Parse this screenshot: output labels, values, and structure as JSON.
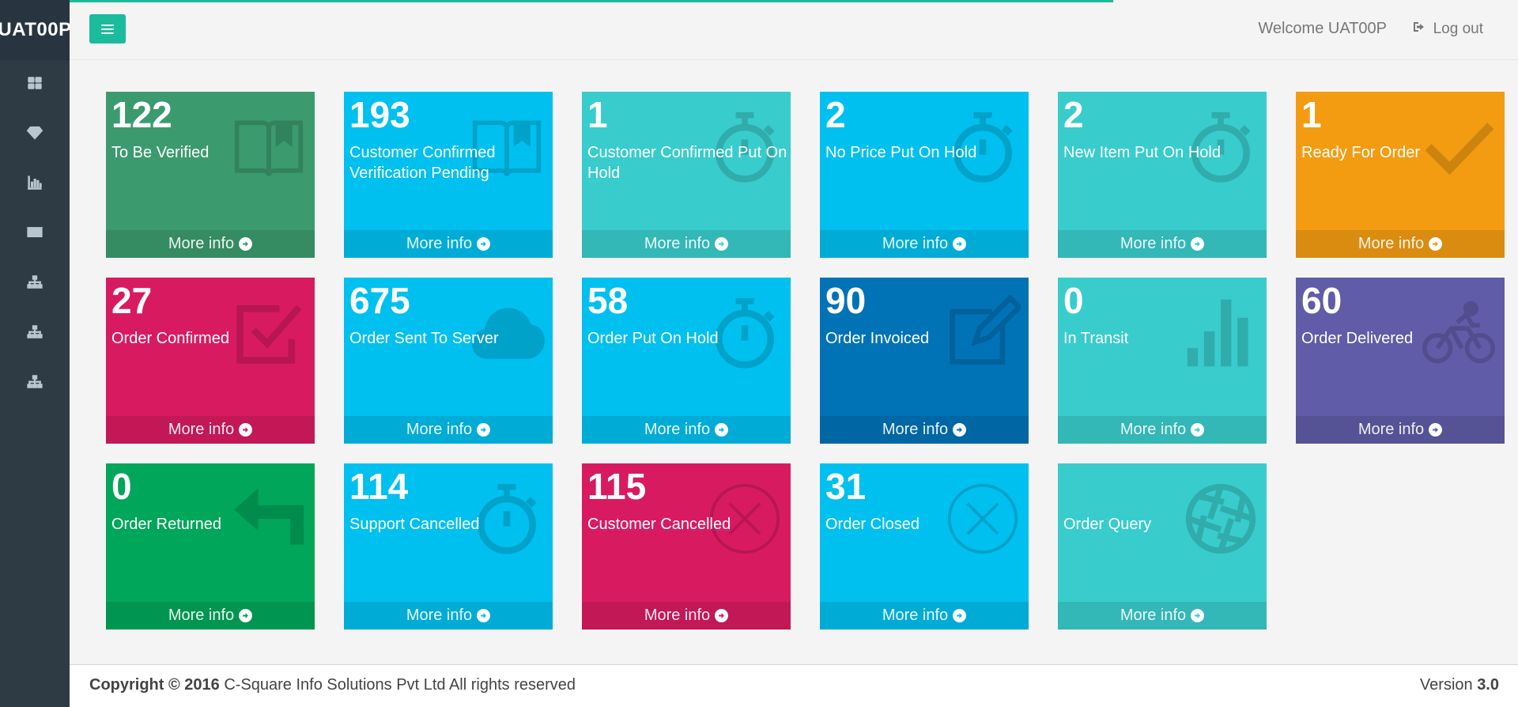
{
  "app": {
    "brand": "UAT00P",
    "welcome": "Welcome UAT00P",
    "logout_label": "Log out"
  },
  "sidebar": {
    "items": [
      {
        "icon": "dashboard-icon"
      },
      {
        "icon": "diamond-icon"
      },
      {
        "icon": "bar-chart-icon"
      },
      {
        "icon": "envelope-icon"
      },
      {
        "icon": "sitemap-icon"
      },
      {
        "icon": "sitemap-icon"
      },
      {
        "icon": "sitemap-icon"
      }
    ]
  },
  "colors": {
    "teal_accent": "#1abc9c",
    "green_dark": "#3c9b6e",
    "aqua": "#00c0ef",
    "turquoise": "#39cccc",
    "orange": "#f39c12",
    "maroon": "#d81b60",
    "blue": "#0073b7",
    "purple": "#605ca8",
    "green": "#00a65a"
  },
  "tiles": [
    {
      "count": "122",
      "label": "To Be Verified",
      "more": "More info",
      "icon": "book-icon",
      "color": "#3c9b6e"
    },
    {
      "count": "193",
      "label": "Customer Confirmed Verification Pending",
      "more": "More info",
      "icon": "book-icon",
      "color": "#00c0ef"
    },
    {
      "count": "1",
      "label": "Customer Confirmed Put On Hold",
      "more": "More info",
      "icon": "stopwatch-icon",
      "color": "#39cccc"
    },
    {
      "count": "2",
      "label": "No Price Put On Hold",
      "more": "More info",
      "icon": "stopwatch-icon",
      "color": "#00c0ef"
    },
    {
      "count": "2",
      "label": "New Item Put On Hold",
      "more": "More info",
      "icon": "stopwatch-icon",
      "color": "#39cccc"
    },
    {
      "count": "1",
      "label": "Ready For Order",
      "more": "More info",
      "icon": "checkmark-icon",
      "color": "#f39c12"
    },
    {
      "count": "27",
      "label": "Order Confirmed",
      "more": "More info",
      "icon": "checkbox-icon",
      "color": "#d81b60"
    },
    {
      "count": "675",
      "label": "Order Sent To Server",
      "more": "More info",
      "icon": "cloud-icon",
      "color": "#00c0ef"
    },
    {
      "count": "58",
      "label": "Order Put On Hold",
      "more": "More info",
      "icon": "stopwatch-icon",
      "color": "#00c0ef"
    },
    {
      "count": "90",
      "label": "Order Invoiced",
      "more": "More info",
      "icon": "edit-icon",
      "color": "#0073b7"
    },
    {
      "count": "0",
      "label": "In Transit",
      "more": "More info",
      "icon": "bar-chart-icon",
      "color": "#39cccc"
    },
    {
      "count": "60",
      "label": "Order Delivered",
      "more": "More info",
      "icon": "bicycle-icon",
      "color": "#605ca8"
    },
    {
      "count": "0",
      "label": "Order Returned",
      "more": "More info",
      "icon": "return-arrow-icon",
      "color": "#00a65a"
    },
    {
      "count": "114",
      "label": "Support Cancelled",
      "more": "More info",
      "icon": "stopwatch-icon",
      "color": "#00c0ef"
    },
    {
      "count": "115",
      "label": "Customer Cancelled",
      "more": "More info",
      "icon": "circle-x-icon",
      "color": "#d81b60"
    },
    {
      "count": "31",
      "label": "Order Closed",
      "more": "More info",
      "icon": "circle-x-icon",
      "color": "#00c0ef"
    },
    {
      "count": "",
      "label": "Order Query",
      "more": "More info",
      "icon": "aperture-icon",
      "color": "#39cccc"
    }
  ],
  "footer": {
    "copyright_bold": "Copyright © 2016",
    "copyright_rest": " C-Square Info Solutions Pvt Ltd All rights reserved",
    "version_label": "Version ",
    "version_number": "3.0"
  }
}
